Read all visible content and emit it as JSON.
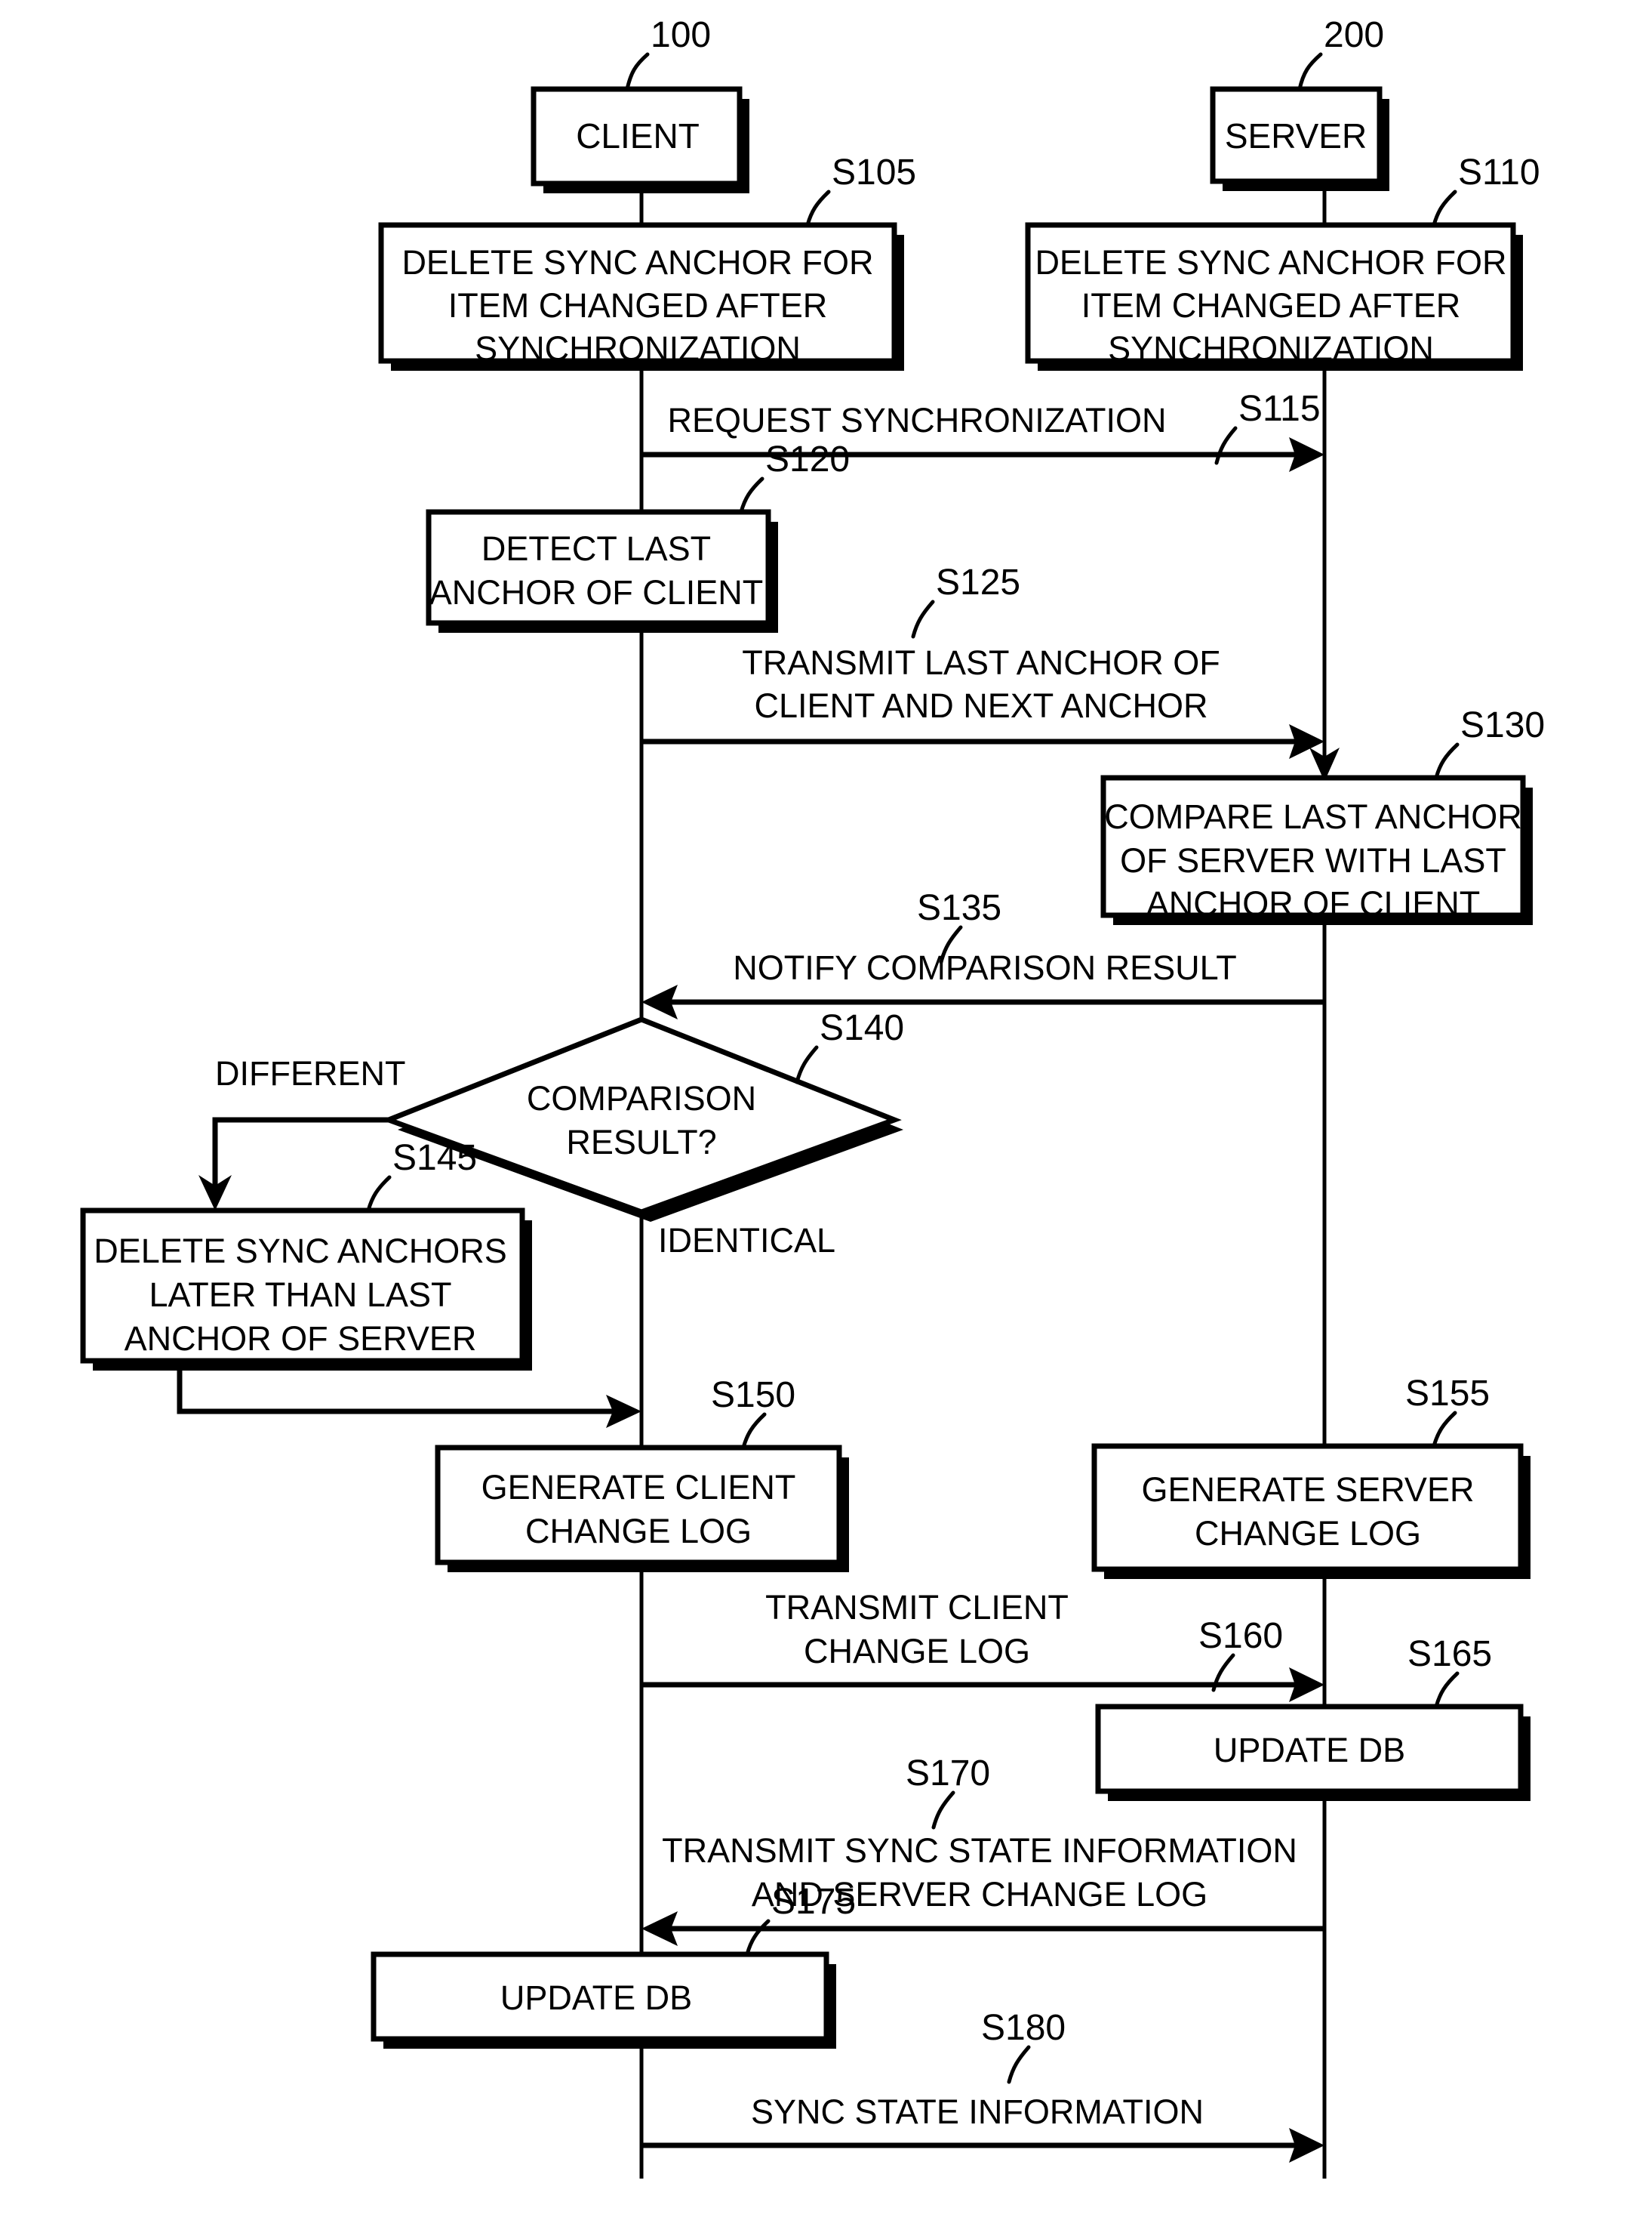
{
  "diagram": {
    "type": "sequence-flowchart",
    "entities": [
      {
        "id": "client",
        "label": "CLIENT",
        "ref": "100"
      },
      {
        "id": "server",
        "label": "SERVER",
        "ref": "200"
      }
    ],
    "process_boxes": [
      {
        "step": "S105",
        "lane": "client",
        "lines": [
          "DELETE SYNC ANCHOR FOR",
          "ITEM CHANGED AFTER",
          "SYNCHRONIZATION"
        ]
      },
      {
        "step": "S110",
        "lane": "server",
        "lines": [
          "DELETE SYNC ANCHOR FOR",
          "ITEM CHANGED AFTER",
          "SYNCHRONIZATION"
        ]
      },
      {
        "step": "S120",
        "lane": "client",
        "lines": [
          "DETECT LAST",
          "ANCHOR OF CLIENT"
        ]
      },
      {
        "step": "S130",
        "lane": "server",
        "lines": [
          "COMPARE LAST ANCHOR",
          "OF SERVER WITH LAST",
          "ANCHOR OF CLIENT"
        ]
      },
      {
        "step": "S145",
        "lane": "branch",
        "lines": [
          "DELETE SYNC ANCHORS",
          "LATER THAN LAST",
          "ANCHOR OF SERVER"
        ]
      },
      {
        "step": "S150",
        "lane": "client",
        "lines": [
          "GENERATE CLIENT",
          "CHANGE LOG"
        ]
      },
      {
        "step": "S155",
        "lane": "server",
        "lines": [
          "GENERATE SERVER",
          "CHANGE LOG"
        ]
      },
      {
        "step": "S165",
        "lane": "server",
        "lines": [
          "UPDATE DB"
        ]
      },
      {
        "step": "S175",
        "lane": "client",
        "lines": [
          "UPDATE DB"
        ]
      }
    ],
    "decision": {
      "step": "S140",
      "lines": [
        "COMPARISON",
        "RESULT?"
      ],
      "branches": [
        {
          "label": "DIFFERENT",
          "direction": "left"
        },
        {
          "label": "IDENTICAL",
          "direction": "down"
        }
      ]
    },
    "messages": [
      {
        "step": "S115",
        "from": "client",
        "to": "server",
        "lines": [
          "REQUEST SYNCHRONIZATION"
        ]
      },
      {
        "step": "S125",
        "from": "client",
        "to": "server",
        "lines": [
          "TRANSMIT LAST ANCHOR OF",
          "CLIENT AND NEXT ANCHOR"
        ]
      },
      {
        "step": "S135",
        "from": "server",
        "to": "client",
        "lines": [
          "NOTIFY COMPARISON RESULT"
        ]
      },
      {
        "step": "S160",
        "from": "client",
        "to": "server",
        "lines": [
          "TRANSMIT CLIENT",
          "CHANGE LOG"
        ]
      },
      {
        "step": "S170",
        "from": "server",
        "to": "client",
        "lines": [
          "TRANSMIT SYNC STATE INFORMATION",
          "AND SERVER CHANGE LOG"
        ]
      },
      {
        "step": "S180",
        "from": "client",
        "to": "server",
        "lines": [
          "SYNC STATE INFORMATION"
        ]
      }
    ],
    "step_labels": [
      "S105",
      "S110",
      "S115",
      "S120",
      "S125",
      "S130",
      "S135",
      "S140",
      "S145",
      "S150",
      "S155",
      "S160",
      "S165",
      "S170",
      "S175",
      "S180"
    ],
    "colors": {
      "ink": "#000000",
      "paper": "#ffffff"
    }
  }
}
